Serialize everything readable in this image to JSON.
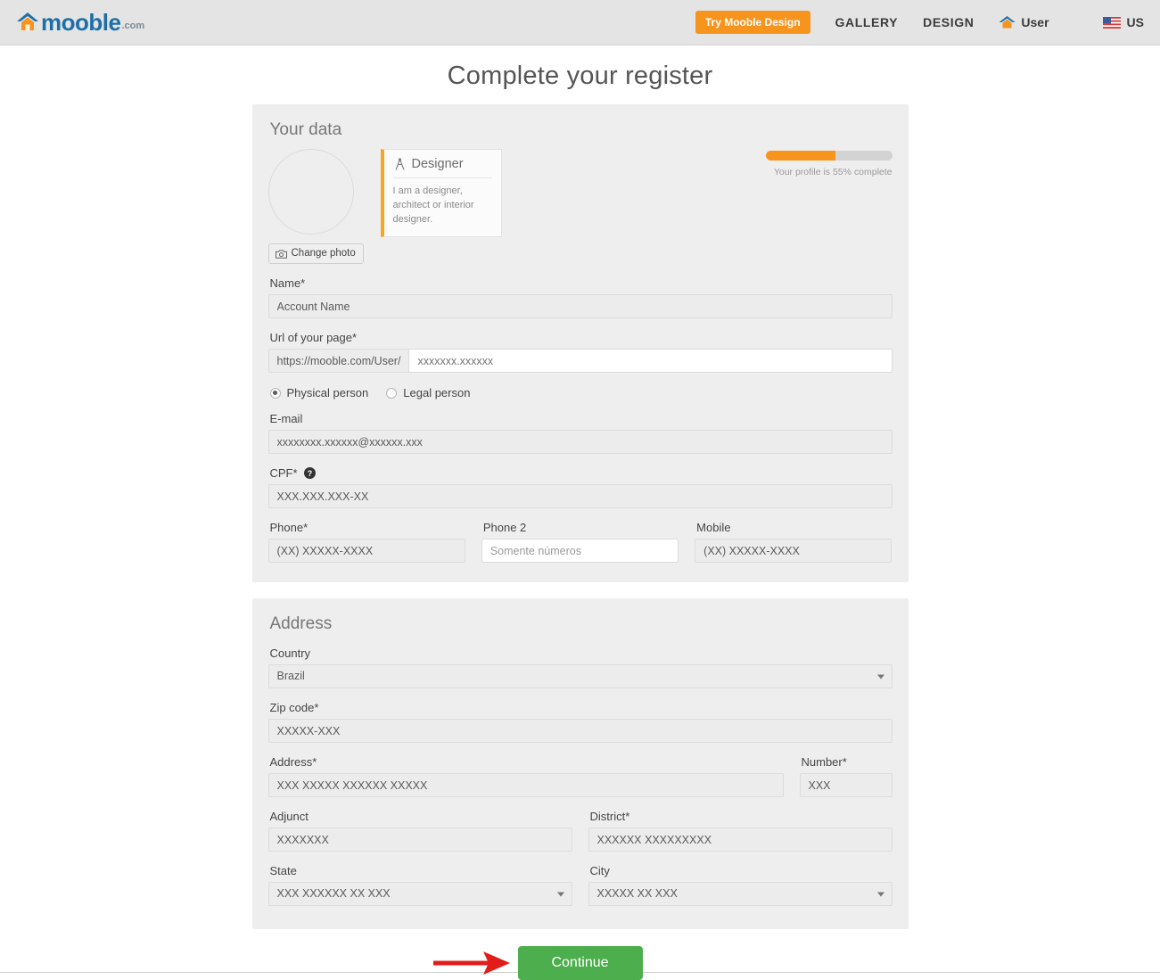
{
  "header": {
    "logo": {
      "name": "mooble",
      "suffix": ".com",
      "icon": "house-icon"
    },
    "try_button": "Try Mooble Design",
    "nav": [
      {
        "label": "GALLERY",
        "name": "gallery"
      },
      {
        "label": "DESIGN",
        "name": "design"
      }
    ],
    "user": {
      "label": "User",
      "icon": "house-icon"
    },
    "locale": {
      "label": "US",
      "icon": "us-flag-icon"
    }
  },
  "page": {
    "title": "Complete your register"
  },
  "your_data": {
    "title": "Your data",
    "change_photo": "Change photo",
    "role_card": {
      "title": "Designer",
      "description": "I am a designer, architect or interior designer."
    },
    "progress": {
      "percent": 55,
      "label": "Your profile is 55% complete"
    },
    "fields": {
      "name": {
        "label": "Name*",
        "value": "Account Name"
      },
      "url": {
        "label": "Url of your page*",
        "prefix": "https://mooble.com/User/",
        "placeholder": "xxxxxxx.xxxxxx"
      },
      "person_type": {
        "physical": "Physical person",
        "legal": "Legal person",
        "selected": "physical"
      },
      "email": {
        "label": "E-mail",
        "value": "xxxxxxxx.xxxxxx@xxxxxx.xxx"
      },
      "cpf": {
        "label": "CPF*",
        "value": "XXX.XXX.XXX-XX",
        "help_icon": "help-circle-icon"
      },
      "phone": {
        "label": "Phone*",
        "value": "(XX) XXXXX-XXXX"
      },
      "phone2": {
        "label": "Phone 2",
        "placeholder": "Somente números"
      },
      "mobile": {
        "label": "Mobile",
        "value": "(XX) XXXXX-XXXX"
      }
    }
  },
  "address": {
    "title": "Address",
    "fields": {
      "country": {
        "label": "Country",
        "value": "Brazil"
      },
      "zip": {
        "label": "Zip code*",
        "value": "XXXXX-XXX"
      },
      "street": {
        "label": "Address*",
        "value": "XXX XXXXX XXXXXX XXXXX"
      },
      "number": {
        "label": "Number*",
        "value": "XXX"
      },
      "adjunct": {
        "label": "Adjunct",
        "value": "XXXXXXX"
      },
      "district": {
        "label": "District*",
        "value": "XXXXXX XXXXXXXXX"
      },
      "state": {
        "label": "State",
        "value": "XXX XXXXXX XX XXX"
      },
      "city": {
        "label": "City",
        "value": "XXXXX XX XXX"
      }
    }
  },
  "footer": {
    "continue_button": "Continue",
    "annotation_arrow": "red-arrow-annotation"
  },
  "colors": {
    "brand_orange": "#f7941e",
    "brand_blue": "#1e6fa8",
    "continue_green": "#4cae4c",
    "annotation_red": "#e21b1b",
    "panel_gray": "#eeeeee"
  }
}
